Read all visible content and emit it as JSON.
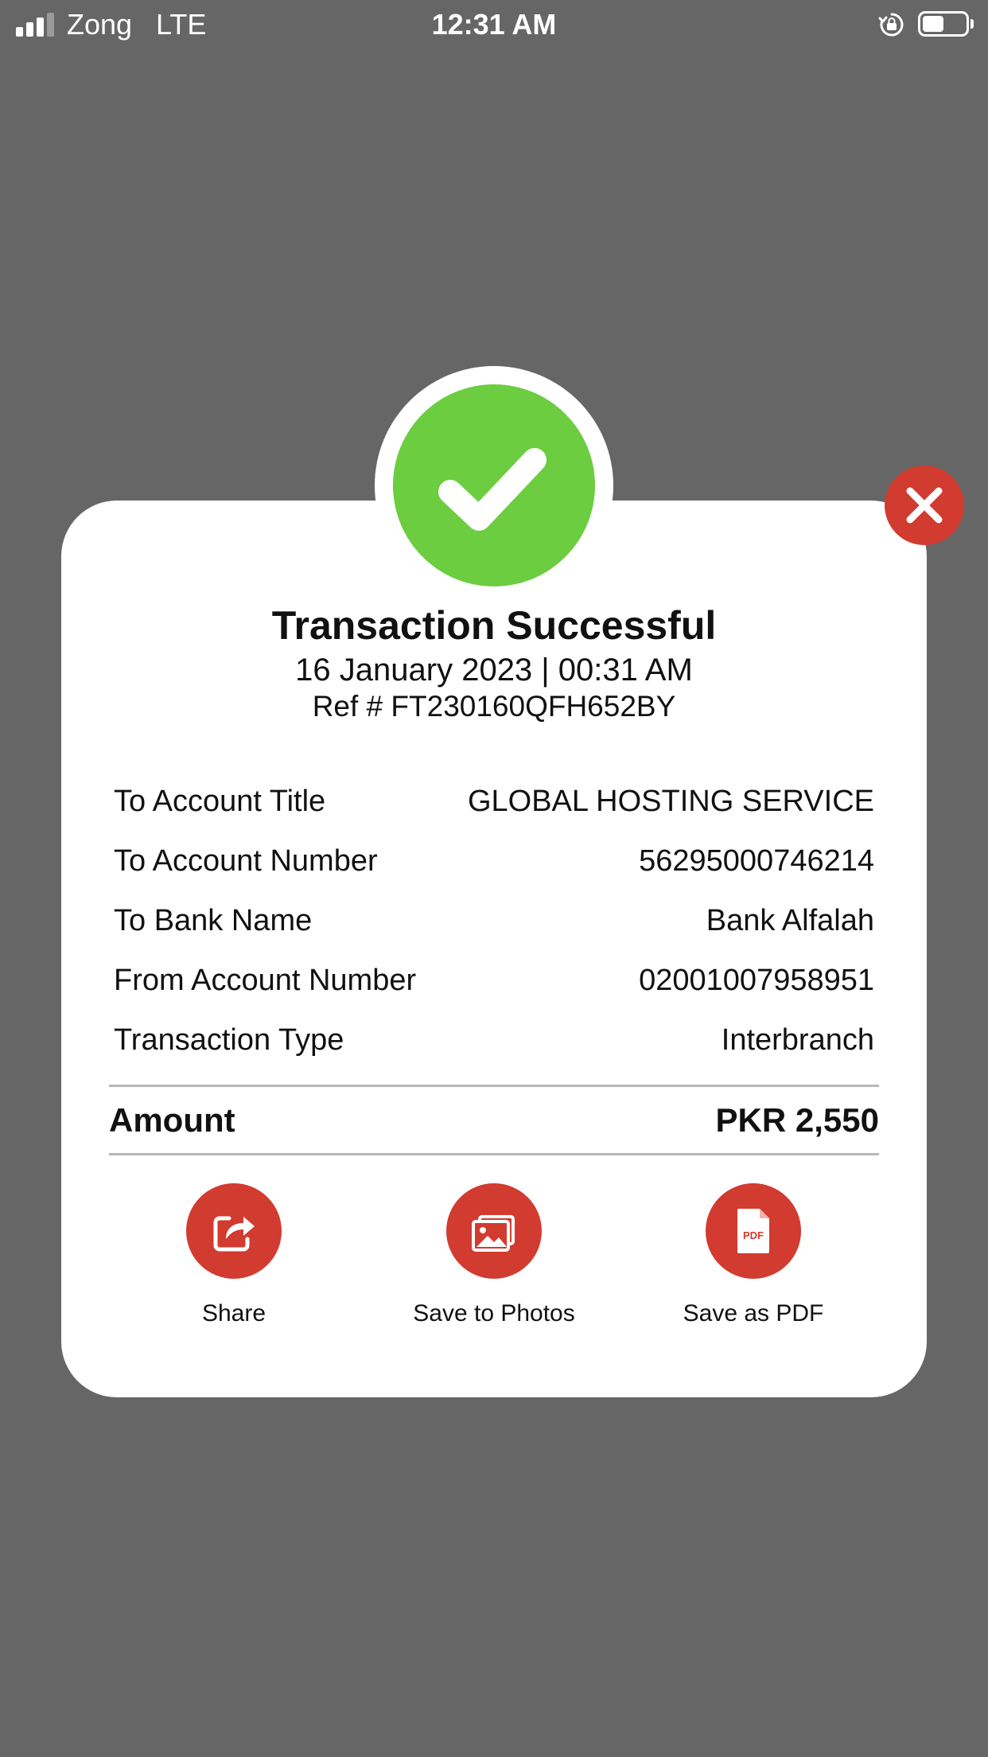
{
  "status_bar": {
    "carrier": "Zong   LTE",
    "time": "12:31 AM",
    "signal_bars_filled": 3,
    "signal_bars_total": 4,
    "battery_level": 0.5,
    "icons": [
      "signal-icon",
      "rotation-lock-icon",
      "battery-icon"
    ]
  },
  "receipt": {
    "title": "Transaction Successful",
    "datetime": "16 January 2023 | 00:31 AM",
    "reference": "Ref # FT230160QFH652BY",
    "rows": [
      {
        "label": "To Account Title",
        "value": "GLOBAL HOSTING SERVICE"
      },
      {
        "label": "To Account Number",
        "value": "56295000746214"
      },
      {
        "label": "To Bank Name",
        "value": "Bank Alfalah"
      },
      {
        "label": "From Account Number",
        "value": "02001007958951"
      },
      {
        "label": "Transaction Type",
        "value": "Interbranch"
      }
    ],
    "amount_label": "Amount",
    "amount_value": "PKR 2,550"
  },
  "actions": {
    "share": {
      "label": "Share",
      "icon": "share-icon"
    },
    "save_photos": {
      "label": "Save to Photos",
      "icon": "photos-icon"
    },
    "save_pdf": {
      "label": "Save as PDF",
      "icon": "pdf-icon"
    }
  },
  "colors": {
    "background": "#666666",
    "card": "#ffffff",
    "success_green": "#6bcd3f",
    "accent_red": "#d23b2f",
    "text": "#111111",
    "divider": "#b8b8b8"
  }
}
